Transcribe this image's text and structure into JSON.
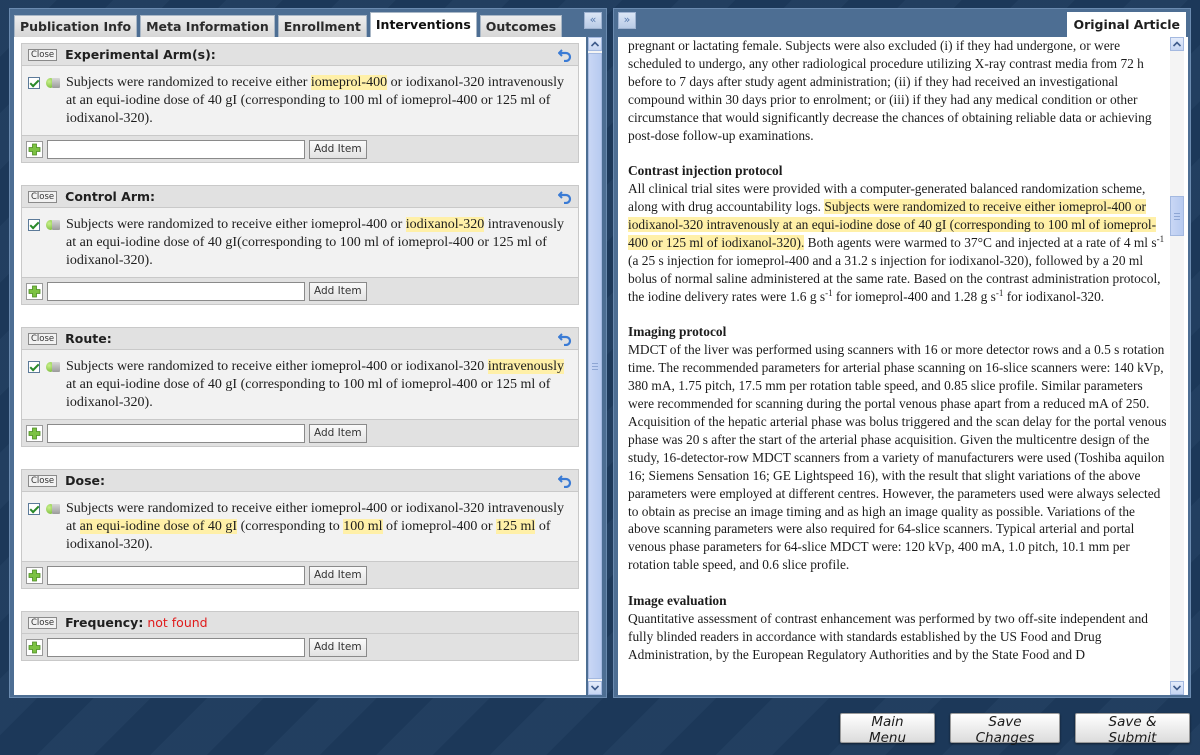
{
  "left_panel": {
    "tabs": [
      {
        "label": "Publication Info",
        "active": false
      },
      {
        "label": "Meta Information",
        "active": false
      },
      {
        "label": "Enrollment",
        "active": false
      },
      {
        "label": "Interventions",
        "active": true
      },
      {
        "label": "Outcomes",
        "active": false
      }
    ],
    "collapse_label": "«",
    "close_label": "Close",
    "add_item_label": "Add Item",
    "add_input_value": "",
    "sections": [
      {
        "title": "Experimental Arm(s):",
        "status": "",
        "items": [
          {
            "checked": true,
            "segments": [
              {
                "text": "Subjects were randomized to receive either ",
                "hl": false
              },
              {
                "text": "iomeprol-400",
                "hl": true
              },
              {
                "text": " or iodixanol-320 intravenously at an equi-iodine dose of 40 gI (corresponding to 100 ml of iomeprol-400 or 125 ml of iodixanol-320).",
                "hl": false
              }
            ]
          }
        ]
      },
      {
        "title": "Control Arm:",
        "status": "",
        "items": [
          {
            "checked": true,
            "segments": [
              {
                "text": "Subjects were randomized to receive either iomeprol-400 or ",
                "hl": false
              },
              {
                "text": "iodixanol-320",
                "hl": true
              },
              {
                "text": " intravenously at an equi-iodine dose of 40 gI(corresponding to 100 ml of iomeprol-400 or 125 ml of iodixanol-320).",
                "hl": false
              }
            ]
          }
        ]
      },
      {
        "title": "Route:",
        "status": "",
        "items": [
          {
            "checked": true,
            "segments": [
              {
                "text": "Subjects were randomized to receive either iomeprol-400 or iodixanol-320 ",
                "hl": false
              },
              {
                "text": "intravenously",
                "hl": true
              },
              {
                "text": " at an equi-iodine dose of 40 gI (corresponding to 100 ml of iomeprol-400 or 125 ml of iodixanol-320).",
                "hl": false
              }
            ]
          }
        ]
      },
      {
        "title": "Dose:",
        "status": "",
        "items": [
          {
            "checked": true,
            "segments": [
              {
                "text": "Subjects were randomized to receive either iomeprol-400 or iodixanol-320 intravenously at ",
                "hl": false
              },
              {
                "text": "an equi-iodine dose of 40 gI",
                "hl": true
              },
              {
                "text": " (corresponding to ",
                "hl": false
              },
              {
                "text": "100 ml",
                "hl": true
              },
              {
                "text": " of iomeprol-400 or ",
                "hl": false
              },
              {
                "text": "125 ml",
                "hl": true
              },
              {
                "text": " of iodixanol-320).",
                "hl": false
              }
            ]
          }
        ]
      },
      {
        "title": "Frequency:",
        "status": "not found",
        "items": []
      }
    ]
  },
  "right_panel": {
    "collapse_label": "»",
    "tab_label": "Original Article",
    "article": {
      "intro": "pregnant or lactating female. Subjects were also excluded (i) if they had undergone, or were scheduled to undergo, any other radiological procedure utilizing X-ray contrast media from 72 h before to 7 days after study agent administration; (ii) if they had received an investigational compound within 30 days prior to enrolment; or (iii) if they had any medical condition or other circumstance that would significantly decrease the chances of obtaining reliable data or achieving post-dose follow-up examinations.",
      "contrast": {
        "heading": "Contrast injection protocol",
        "before": "All clinical trial sites were provided with a computer-generated balanced randomization scheme, along with drug accountability logs. ",
        "highlight": "Subjects were randomized to receive either iomeprol-400 or iodixanol-320 intravenously at an equi-iodine dose of 40 gI (corresponding to 100 ml of iomeprol-400 or 125 ml of iodixanol-320).",
        "after1": " Both agents were warmed to 37°C and injected at a rate of 4 ml s",
        "sup": "-1",
        "after2": " (a 25 s injection for iomeprol-400 and a 31.2 s injection for iodixanol-320), followed by a 20 ml bolus of normal saline administered at the same rate. Based on the contrast administration protocol, the iodine delivery rates were 1.6 g s",
        "after3": " for iomeprol-400 and 1.28 g s",
        "after4": " for iodixanol-320."
      },
      "imaging": {
        "heading": "Imaging protocol",
        "text": "MDCT of the liver was performed using scanners with 16 or more detector rows and a 0.5 s rotation time. The recommended parameters for arterial phase scanning on 16-slice scanners were: 140 kVp, 380 mA, 1.75 pitch, 17.5 mm per rotation table speed, and 0.85 slice profile. Similar parameters were recommended for scanning during the portal venous phase apart from a reduced mA of 250. Acquisition of the hepatic arterial phase was bolus triggered and the scan delay for the portal venous phase was 20 s after the start of the arterial phase acquisition. Given the multicentre design of the study, 16-detector-row MDCT scanners from a variety of manufacturers were used (Toshiba aquilon 16; Siemens Sensation 16; GE Lightspeed 16), with the result that slight variations of the above parameters were employed at different centres. However, the parameters used were always selected to obtain as precise an image timing and as high an image quality as possible. Variations of the above scanning parameters were also required for 64-slice scanners. Typical arterial and portal venous phase parameters for 64-slice MDCT were: 120 kVp, 400 mA, 1.0 pitch, 10.1 mm per rotation table speed, and 0.6 slice profile."
      },
      "evaluation": {
        "heading": "Image evaluation",
        "text": "Quantitative assessment of contrast enhancement was performed by two off-site independent and fully blinded readers in accordance with standards established by the US Food and Drug Administration, by the European Regulatory Authorities and by the State Food and D"
      }
    }
  },
  "bottom_buttons": {
    "main_menu": "Main Menu",
    "save_changes": "Save Changes",
    "save_submit": "Save & Submit"
  },
  "colors": {
    "highlight": "#fff0a8",
    "not_found": "#e01b1b",
    "background": "#1d3a5c"
  }
}
